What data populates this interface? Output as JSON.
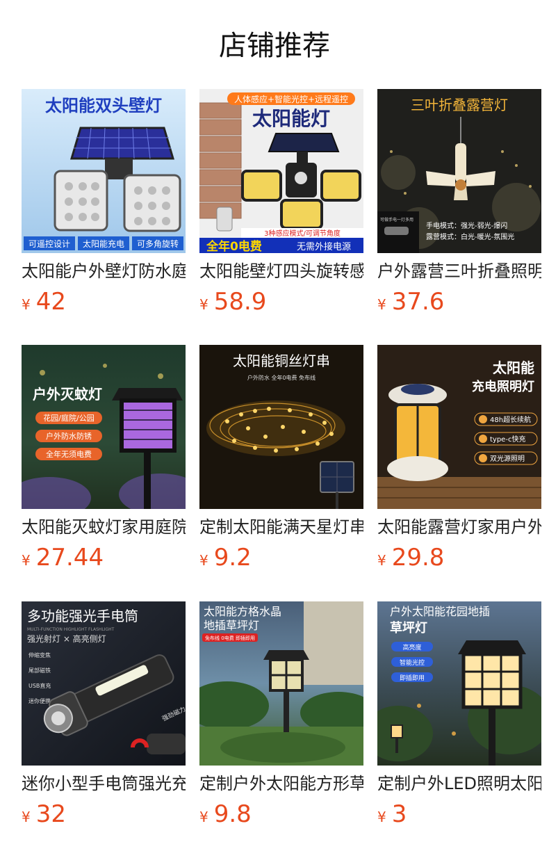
{
  "page": {
    "title": "店铺推荐"
  },
  "currency": "¥",
  "products": [
    {
      "name": "太阳能户外壁灯防水庭院灯",
      "price": "42",
      "image": {
        "theme": "sky",
        "texts": [
          "太阳能双头壁灯",
          "可遥控设计",
          "太阳能充电",
          "可多角旋转"
        ]
      }
    },
    {
      "name": "太阳能壁灯四头旋转感应灯",
      "price": "58.9",
      "image": {
        "theme": "brick",
        "texts": [
          "人体感应+智能光控+远程遥控",
          "太阳能灯",
          "3种感应模式/可调节角度",
          "全年0电费",
          "无需外接电源"
        ]
      }
    },
    {
      "name": "户外露营三叶折叠照明灯",
      "price": "37.6",
      "image": {
        "theme": "night-camp",
        "texts": [
          "三叶折叠露营灯",
          "可做手电一灯多用",
          "手电模式：强光-弱光-爆闪",
          "露营模式：白光-暖光-氛围光"
        ]
      }
    },
    {
      "name": "太阳能灭蚊灯家用庭院灯",
      "price": "27.44",
      "image": {
        "theme": "garden-purple",
        "texts": [
          "户外灭蚊灯",
          "花园/庭院/公园",
          "户外防水防锈",
          "全年无须电费"
        ]
      }
    },
    {
      "name": "定制太阳能满天星灯串",
      "price": "9.2",
      "image": {
        "theme": "string-lights",
        "texts": [
          "太阳能铜丝灯串",
          "户外防水 全年0电费 免布线"
        ]
      }
    },
    {
      "name": "太阳能露营灯家用户外灯",
      "price": "29.8",
      "image": {
        "theme": "lantern",
        "texts": [
          "太阳能",
          "充电照明灯",
          "48h超长续航",
          "type-c快充",
          "双光源照明"
        ]
      }
    },
    {
      "name": "迷你小型手电筒强光充电",
      "price": "32",
      "image": {
        "theme": "flashlight",
        "texts": [
          "多功能强光手电筒",
          "MULTI-FUNCTION HIGHLIGHT FLASHLIGHT",
          "强光射灯 × 高亮侧灯",
          "伸缩变焦",
          "尾部磁铁",
          "USB直充",
          "迷你便携",
          "强劲磁力"
        ]
      }
    },
    {
      "name": "定制户外太阳能方形草坪灯",
      "price": "9.8",
      "image": {
        "theme": "lawn-day",
        "texts": [
          "太阳能方格水晶",
          "地插草坪灯",
          "免布线 0电费 即插即用"
        ]
      }
    },
    {
      "name": "定制户外LED照明太阳能灯",
      "price": "3",
      "image": {
        "theme": "lawn-dusk",
        "texts": [
          "户外太阳能花园地插",
          "草坪灯",
          "高亮度",
          "智能光控",
          "即插即用"
        ]
      }
    }
  ]
}
